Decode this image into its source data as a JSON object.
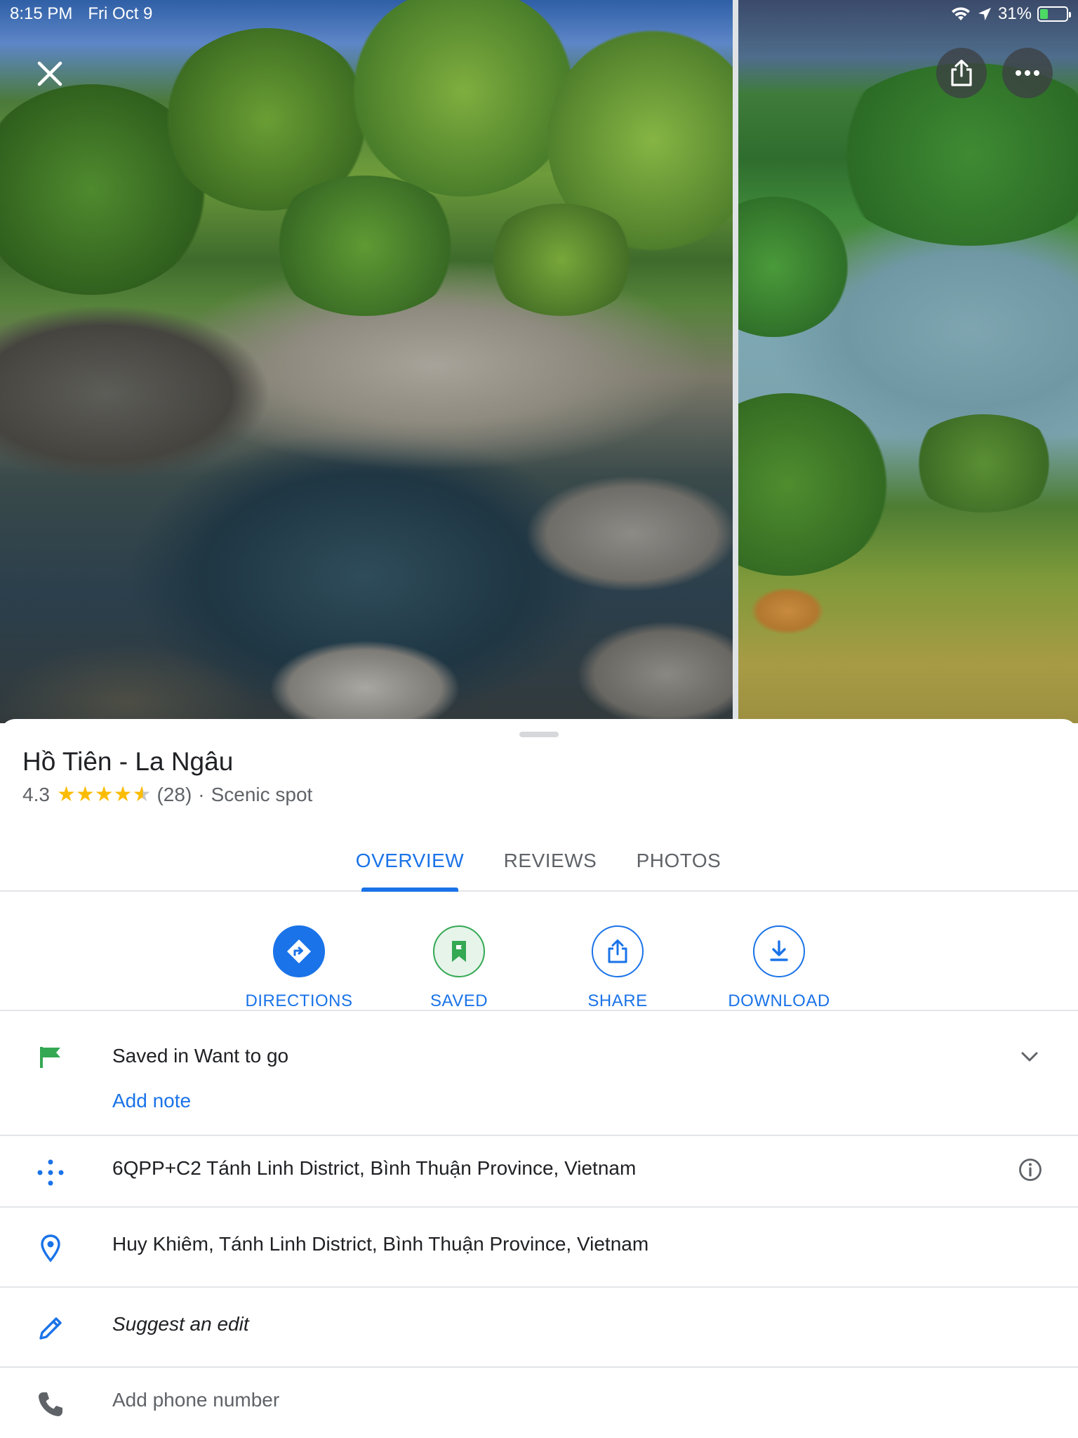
{
  "status_bar": {
    "time": "8:15 PM",
    "date": "Fri Oct 9",
    "battery": "31%",
    "battery_level": 0.31
  },
  "place": {
    "name": "Hồ Tiên - La Ngâu",
    "rating": "4.3",
    "rating_value": 4.3,
    "review_count": "(28)",
    "separator": "·",
    "category": "Scenic spot"
  },
  "tabs": [
    {
      "label": "OVERVIEW",
      "active": true
    },
    {
      "label": "REVIEWS",
      "active": false
    },
    {
      "label": "PHOTOS",
      "active": false
    }
  ],
  "actions": [
    {
      "label": "DIRECTIONS",
      "icon": "directions-icon"
    },
    {
      "label": "SAVED",
      "icon": "bookmark-icon"
    },
    {
      "label": "SHARE",
      "icon": "share-icon"
    },
    {
      "label": "DOWNLOAD",
      "icon": "download-icon"
    }
  ],
  "details": {
    "saved_list": "Saved in Want to go",
    "add_note": "Add note",
    "plus_code": "6QPP+C2 Tánh Linh District, Bình Thuận Province, Vietnam",
    "address": "Huy Khiêm, Tánh Linh District, Bình Thuận Province, Vietnam",
    "suggest_edit": "Suggest an edit",
    "phone": "Add phone number"
  },
  "colors": {
    "accent": "#1a73e8",
    "saved_green": "#34a853",
    "star": "#fbbc04"
  }
}
